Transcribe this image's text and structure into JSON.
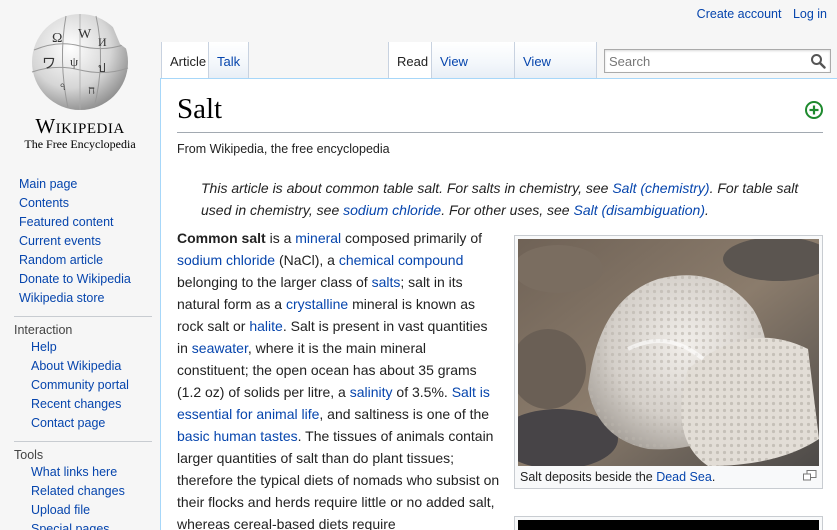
{
  "personal": {
    "create_account": "Create account",
    "log_in": "Log in"
  },
  "logo": {
    "wordmark": "Wikipedia",
    "tagline": "The Free Encyclopedia"
  },
  "nav_main": [
    "Main page",
    "Contents",
    "Featured content",
    "Current events",
    "Random article",
    "Donate to Wikipedia",
    "Wikipedia store"
  ],
  "interaction": {
    "heading": "Interaction",
    "items": [
      "Help",
      "About Wikipedia",
      "Community portal",
      "Recent changes",
      "Contact page"
    ]
  },
  "tools": {
    "heading": "Tools",
    "items": [
      "What links here",
      "Related changes",
      "Upload file",
      "Special pages"
    ]
  },
  "tabs": {
    "article": "Article",
    "talk": "Talk",
    "read": "Read",
    "view_source": "View source",
    "view_history": "View history"
  },
  "search": {
    "placeholder": "Search"
  },
  "article": {
    "title": "Salt",
    "site_sub": "From Wikipedia, the free encyclopedia",
    "hatnote": {
      "t1": "This article is about common table salt. For salts in chemistry, see ",
      "l1": "Salt (chemistry)",
      "t2": ". For table salt used in chemistry, see ",
      "l2": "sodium chloride",
      "t3": ". For other uses, see ",
      "l3": "Salt (disambiguation)",
      "t4": "."
    },
    "lead": [
      {
        "b": "Common salt"
      },
      {
        "t": " is a "
      },
      {
        "l": "mineral"
      },
      {
        "t": " composed primarily of "
      },
      {
        "l": "sodium chloride"
      },
      {
        "t": " (NaCl), a "
      },
      {
        "l": "chemical compound"
      },
      {
        "t": " belonging to the larger class of "
      },
      {
        "l": "salts"
      },
      {
        "t": "; salt in its natural form as a "
      },
      {
        "l": "crystalline"
      },
      {
        "t": " mineral is known as rock salt or "
      },
      {
        "l": "halite"
      },
      {
        "t": ". Salt is present in vast quantities in "
      },
      {
        "l": "seawater"
      },
      {
        "t": ", where it is the main mineral constituent; the open ocean has about 35 grams (1.2 oz) of solids per litre, a "
      },
      {
        "l": "salinity"
      },
      {
        "t": " of 3.5%. "
      },
      {
        "l": "Salt is essential for animal life"
      },
      {
        "t": ", and saltiness is one of the "
      },
      {
        "l": "basic human tastes"
      },
      {
        "t": ". The tissues of animals contain larger quantities of salt than do plant tissues; therefore the typical diets of nomads who subsist on their flocks and herds require little or no added salt, whereas cereal-based diets require"
      }
    ],
    "caption": {
      "text": "Salt deposits beside the ",
      "link": "Dead Sea",
      "end": "."
    }
  },
  "colors": {
    "link": "#0645ad",
    "border": "#a7d7f9",
    "background": "#f6f6f6"
  },
  "icons": [
    "globe-logo",
    "search-icon",
    "add-icon",
    "magnify-icon"
  ]
}
